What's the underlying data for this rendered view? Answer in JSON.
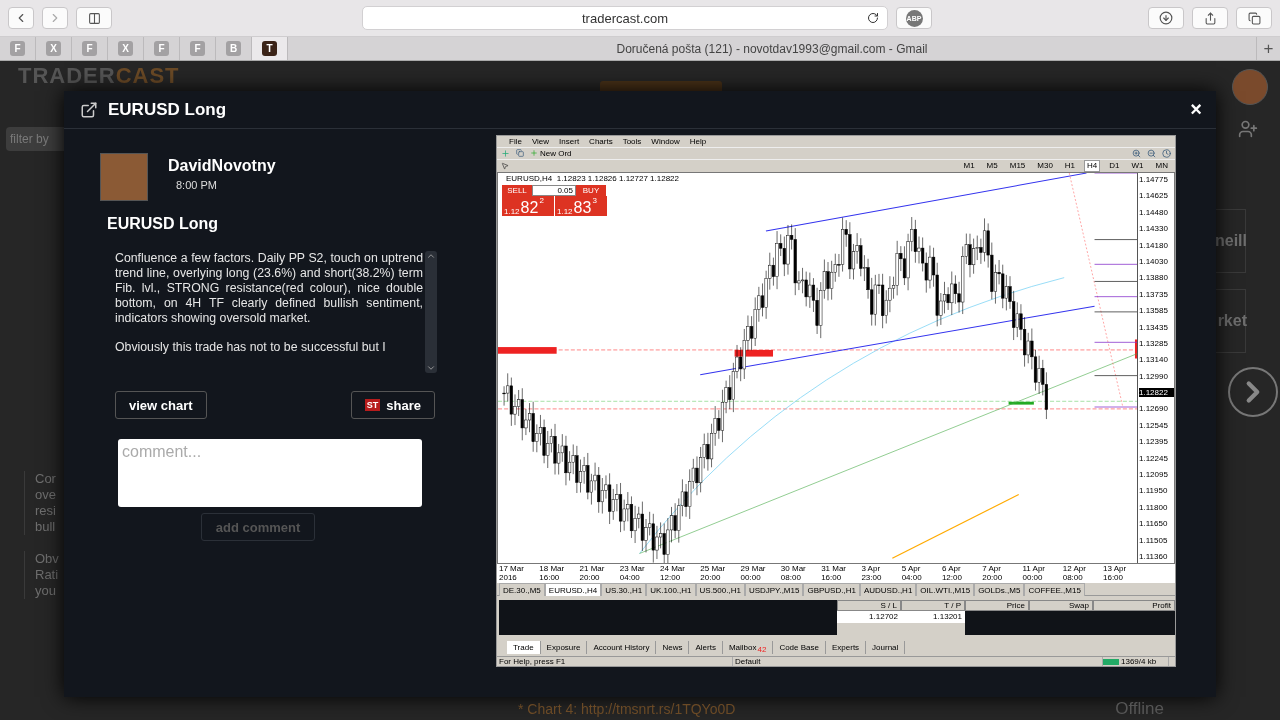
{
  "browser": {
    "url": "tradercast.com",
    "adblock_label": "ABP",
    "pinned_tabs": [
      {
        "letter": "F",
        "selected": false
      },
      {
        "letter": "X",
        "selected": false
      },
      {
        "letter": "F",
        "selected": false
      },
      {
        "letter": "X",
        "selected": false
      },
      {
        "letter": "F",
        "selected": false
      },
      {
        "letter": "F",
        "selected": false
      },
      {
        "letter": "B",
        "selected": false
      },
      {
        "letter": "T",
        "selected": true
      }
    ],
    "tab_title": "Doručená pošta (121) - novotdav1993@gmail.com - Gmail",
    "new_tab": "+"
  },
  "site": {
    "logo_first": "TRADER",
    "logo_second": "CAST",
    "filter_placeholder": "filter by",
    "left_fragments": [
      [
        "Cor",
        "ove",
        "resi",
        "bull"
      ],
      [
        "Obv",
        "Rati",
        "you"
      ]
    ],
    "right_fragments": [
      "neill",
      "rket"
    ],
    "status": "Offline",
    "footer_link": "* Chart 4: http://tmsnrt.rs/1TQYo0D"
  },
  "modal": {
    "title": "EURUSD Long",
    "close": "×",
    "author": "DavidNovotny",
    "time": "8:00 PM",
    "post_title": "EURUSD Long",
    "paragraphs": [
      "Confluence a few factors. Daily PP S2, touch on uptrend trend line, overlying long (23.6%) and short(38.2%) term Fib. lvl., STRONG resistance(red colour), nice double bottom, on 4H TF clearly defined bullish sentiment, indicators showing oversold market.",
      "Obviously this trade has not to be successful but I"
    ],
    "view_chart": "view chart",
    "share_badge": "ST",
    "share": "share",
    "comment_placeholder": "comment...",
    "add_comment": {
      "label": "add comment",
      "disabled": true
    }
  },
  "terminal": {
    "menu": [
      "File",
      "View",
      "Insert",
      "Charts",
      "Tools",
      "Window",
      "Help"
    ],
    "new_order": "New Ord",
    "timeframes": [
      {
        "label": "M1",
        "selected": false
      },
      {
        "label": "M5",
        "selected": false
      },
      {
        "label": "M15",
        "selected": false
      },
      {
        "label": "M30",
        "selected": false
      },
      {
        "label": "H1",
        "selected": false
      },
      {
        "label": "H4",
        "selected": true
      },
      {
        "label": "D1",
        "selected": false
      },
      {
        "label": "W1",
        "selected": false
      },
      {
        "label": "MN",
        "selected": false
      }
    ],
    "chart_header": "EURUSD,H4  1.12823 1.12826 1.12727 1.12822",
    "sell_label": "SELL",
    "buy_label": "BUY",
    "lot": "0.05",
    "sell_price": {
      "prefix": "1.12",
      "big": "82",
      "small": "2"
    },
    "buy_price": {
      "prefix": "1.12",
      "big": "83",
      "small": "3"
    },
    "price_axis": [
      {
        "label": "1.14775",
        "current": false
      },
      {
        "label": "1.14625",
        "current": false
      },
      {
        "label": "1.14480",
        "current": false
      },
      {
        "label": "1.14330",
        "current": false
      },
      {
        "label": "1.14180",
        "current": false
      },
      {
        "label": "1.14030",
        "current": false
      },
      {
        "label": "1.13880",
        "current": false
      },
      {
        "label": "1.13735",
        "current": false
      },
      {
        "label": "1.13585",
        "current": false
      },
      {
        "label": "1.13435",
        "current": false
      },
      {
        "label": "1.13285",
        "current": false
      },
      {
        "label": "1.13140",
        "current": false
      },
      {
        "label": "1.12990",
        "current": false
      },
      {
        "label": "1.12822",
        "current": true
      },
      {
        "label": "1.12690",
        "current": false
      },
      {
        "label": "1.12545",
        "current": false
      },
      {
        "label": "1.12395",
        "current": false
      },
      {
        "label": "1.12245",
        "current": false
      },
      {
        "label": "1.12095",
        "current": false
      },
      {
        "label": "1.11950",
        "current": false
      },
      {
        "label": "1.11800",
        "current": false
      },
      {
        "label": "1.11650",
        "current": false
      },
      {
        "label": "1.11505",
        "current": false
      },
      {
        "label": "1.11360",
        "current": false
      }
    ],
    "time_axis": [
      "17 Mar 2016",
      "18 Mar 16:00",
      "21 Mar 20:00",
      "23 Mar 04:00",
      "24 Mar 12:00",
      "25 Mar 20:00",
      "29 Mar 00:00",
      "30 Mar 08:00",
      "31 Mar 16:00",
      "3 Apr 23:00",
      "5 Apr 04:00",
      "6 Apr 12:00",
      "7 Apr 20:00",
      "11 Apr 00:00",
      "12 Apr 08:00",
      "13 Apr 16:00"
    ],
    "chart_tabs": [
      {
        "label": "DE.30.,M5",
        "selected": false
      },
      {
        "label": "EURUSD.,H4",
        "selected": true
      },
      {
        "label": "US.30.,H1",
        "selected": false
      },
      {
        "label": "UK.100.,H1",
        "selected": false
      },
      {
        "label": "US.500.,H1",
        "selected": false
      },
      {
        "label": "USDJPY.,M15",
        "selected": false
      },
      {
        "label": "GBPUSD.,H1",
        "selected": false
      },
      {
        "label": "AUDUSD.,H1",
        "selected": false
      },
      {
        "label": "OIL.WTI.,M15",
        "selected": false
      },
      {
        "label": "GOLDs.,M5",
        "selected": false
      },
      {
        "label": "COFFEE.,M15",
        "selected": false
      }
    ],
    "columns": [
      "S / L",
      "T / P",
      "Price",
      "Swap",
      "Profit"
    ],
    "row": [
      "1.12702",
      "1.13201"
    ],
    "terminal_tabs": [
      {
        "label": "Trade",
        "selected": true
      },
      {
        "label": "Exposure",
        "selected": false
      },
      {
        "label": "Account History",
        "selected": false
      },
      {
        "label": "News",
        "selected": false
      },
      {
        "label": "Alerts",
        "selected": false
      },
      {
        "label": "Mailbox",
        "selected": false,
        "badge": "42"
      },
      {
        "label": "Code Base",
        "selected": false
      },
      {
        "label": "Experts",
        "selected": false
      },
      {
        "label": "Journal",
        "selected": false
      }
    ],
    "status": [
      "For Help, press F1",
      "Default",
      "1369/4 kb"
    ]
  }
}
